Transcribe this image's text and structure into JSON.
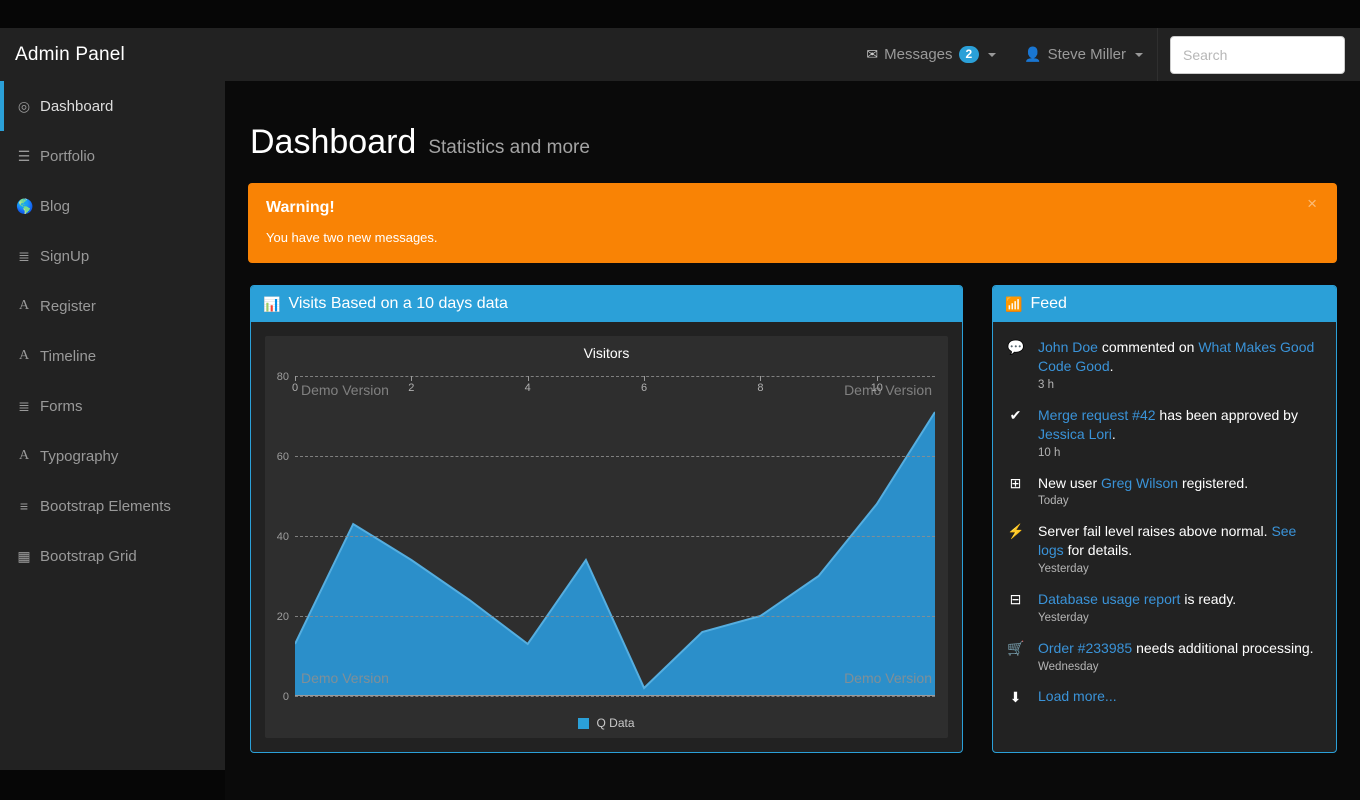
{
  "navbar": {
    "brand": "Admin Panel",
    "messages": {
      "icon": "envelope-icon",
      "label": "Messages",
      "badge": "2"
    },
    "user": {
      "icon": "user-icon",
      "label": "Steve Miller"
    },
    "search": {
      "placeholder": "Search",
      "value": ""
    }
  },
  "sidebar": {
    "items": [
      {
        "label": "Dashboard",
        "icon": "bullseye-icon",
        "active": true
      },
      {
        "label": "Portfolio",
        "icon": "th-list-icon",
        "active": false
      },
      {
        "label": "Blog",
        "icon": "globe-icon",
        "active": false
      },
      {
        "label": "SignUp",
        "icon": "list-ol-icon",
        "active": false
      },
      {
        "label": "Register",
        "icon": "font-icon",
        "active": false
      },
      {
        "label": "Timeline",
        "icon": "font-icon",
        "active": false
      },
      {
        "label": "Forms",
        "icon": "list-ol-icon",
        "active": false
      },
      {
        "label": "Typography",
        "icon": "font-icon",
        "active": false
      },
      {
        "label": "Bootstrap Elements",
        "icon": "list-ul-icon",
        "active": false
      },
      {
        "label": "Bootstrap Grid",
        "icon": "table-icon",
        "active": false
      }
    ]
  },
  "page": {
    "title": "Dashboard",
    "subtitle": "Statistics and more"
  },
  "alert": {
    "title": "Warning!",
    "text": "You have two new messages.",
    "close_label": "×",
    "color": "#f98305"
  },
  "chart_panel": {
    "icon": "bar-chart-icon",
    "title": "Visits Based on a 10 days data"
  },
  "chart_data": {
    "type": "area",
    "title": "Visitors",
    "xlabel": "",
    "ylabel": "",
    "x": [
      0,
      1,
      2,
      3,
      4,
      5,
      6,
      7,
      8,
      9,
      10,
      11
    ],
    "series": [
      {
        "name": "Q Data",
        "color": "#2b8fca",
        "values": [
          13,
          43,
          34,
          24,
          13,
          34,
          2,
          16,
          20,
          30,
          48,
          71
        ]
      }
    ],
    "xticks": [
      "0",
      "2",
      "4",
      "6",
      "8",
      "10"
    ],
    "xtick_values": [
      0,
      2,
      4,
      6,
      8,
      10
    ],
    "yticks": [
      "0",
      "20",
      "40",
      "60",
      "80"
    ],
    "ytick_values": [
      0,
      20,
      40,
      60,
      80
    ],
    "xlim": [
      0,
      11
    ],
    "ylim": [
      0,
      80
    ],
    "grid": true,
    "legend": {
      "position": "bottom",
      "entries": [
        "Q Data"
      ]
    },
    "watermarks": [
      "Demo Version",
      "Demo Version",
      "Demo Version",
      "Demo Version"
    ]
  },
  "feed_panel": {
    "icon": "rss-icon",
    "title": "Feed",
    "items": [
      {
        "icon": "comment-icon",
        "parts": [
          {
            "text": "John Doe",
            "link": true
          },
          {
            "text": " commented on ",
            "link": false
          },
          {
            "text": "What Makes Good Code Good",
            "link": true
          },
          {
            "text": ".",
            "link": false
          }
        ],
        "time": "3 h"
      },
      {
        "icon": "check-icon",
        "parts": [
          {
            "text": "Merge request #42",
            "link": true
          },
          {
            "text": " has been approved by ",
            "link": false
          },
          {
            "text": "Jessica Lori",
            "link": true
          },
          {
            "text": ".",
            "link": false
          }
        ],
        "time": "10 h"
      },
      {
        "icon": "plus-square-icon",
        "parts": [
          {
            "text": "New user ",
            "link": false
          },
          {
            "text": "Greg Wilson",
            "link": true
          },
          {
            "text": " registered.",
            "link": false
          }
        ],
        "time": "Today"
      },
      {
        "icon": "bolt-icon",
        "parts": [
          {
            "text": "Server fail level raises above normal. ",
            "link": false
          },
          {
            "text": "See logs",
            "link": true
          },
          {
            "text": " for details.",
            "link": false
          }
        ],
        "time": "Yesterday"
      },
      {
        "icon": "minus-square-icon",
        "parts": [
          {
            "text": "Database usage report",
            "link": true
          },
          {
            "text": " is ready.",
            "link": false
          }
        ],
        "time": "Yesterday"
      },
      {
        "icon": "shopping-cart-icon",
        "parts": [
          {
            "text": "Order #233985",
            "link": true
          },
          {
            "text": " needs additional processing.",
            "link": false
          }
        ],
        "time": "Wednesday"
      }
    ],
    "load_more": {
      "icon": "arrow-down-icon",
      "label": "Load more..."
    }
  },
  "theme": {
    "accent": "#2ba0d8",
    "link": "#3a93d8",
    "panel_bg": "#222222",
    "chart_bg": "#2e2e2e",
    "page_bg": "#0a0a0a"
  }
}
